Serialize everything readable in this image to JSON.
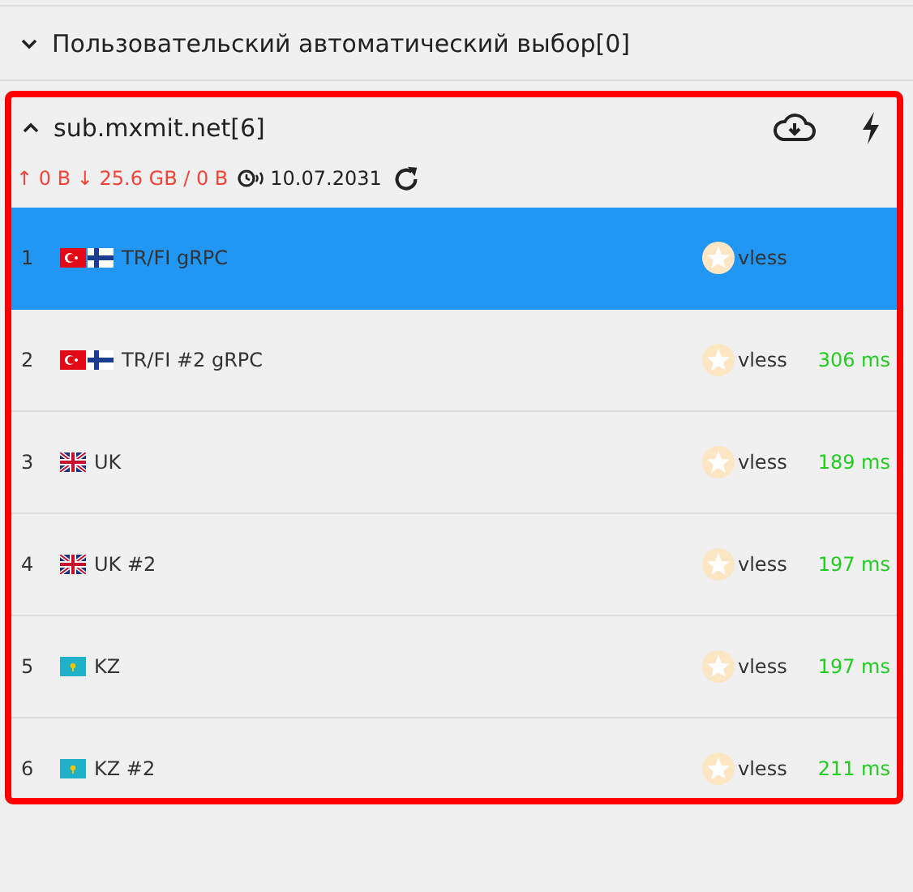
{
  "groups": [
    {
      "title": "Пользовательский автоматический выбор[0]",
      "expanded": false
    }
  ],
  "subscription": {
    "title": "sub.mxmit.net[6]",
    "expanded": true,
    "traffic": "↑ 0 B ↓ 25.6 GB / 0 B",
    "expires": "10.07.2031",
    "servers": [
      {
        "index": "1",
        "flags": [
          {
            "kind": "tr"
          },
          {
            "kind": "fi"
          }
        ],
        "name": "TR/FI gRPC",
        "protocol": "vless",
        "selected": true
      },
      {
        "index": "2",
        "flags": [
          {
            "kind": "tr"
          },
          {
            "kind": "fi"
          }
        ],
        "name": "TR/FI #2 gRPC",
        "protocol": "vless",
        "latency": "306 ms",
        "selected": false
      },
      {
        "index": "3",
        "flags": [
          {
            "kind": "uk"
          }
        ],
        "name": "UK",
        "protocol": "vless",
        "latency": "189 ms",
        "selected": false
      },
      {
        "index": "4",
        "flags": [
          {
            "kind": "uk"
          }
        ],
        "name": "UK #2",
        "protocol": "vless",
        "latency": "197 ms",
        "selected": false
      },
      {
        "index": "5",
        "flags": [
          {
            "kind": "kz"
          }
        ],
        "name": "KZ",
        "protocol": "vless",
        "latency": "197 ms",
        "selected": false
      },
      {
        "index": "6",
        "flags": [
          {
            "kind": "kz"
          }
        ],
        "name": "KZ #2",
        "protocol": "vless",
        "latency": "211 ms",
        "selected": false
      }
    ]
  }
}
